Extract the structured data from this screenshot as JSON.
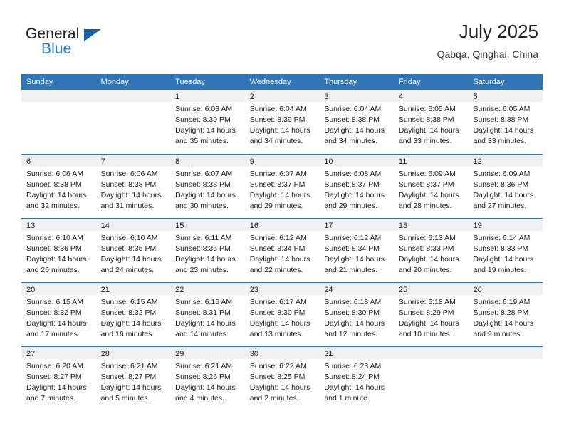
{
  "brand": {
    "name_part1": "General",
    "name_part2": "Blue",
    "triangle_icon": "triangle-icon",
    "accent_color": "#2b7cc4",
    "triangle_color": "#1360a8"
  },
  "header": {
    "title": "July 2025",
    "subtitle": "Qabqa, Qinghai, China"
  },
  "calendar": {
    "header_bg": "#3075b5",
    "day_band_bg": "#f0f0f0",
    "weekdays": [
      "Sunday",
      "Monday",
      "Tuesday",
      "Wednesday",
      "Thursday",
      "Friday",
      "Saturday"
    ],
    "weeks": [
      [
        {
          "day": "",
          "empty": true,
          "sunrise": "",
          "sunset": "",
          "daylight_1": "",
          "daylight_2": ""
        },
        {
          "day": "",
          "empty": true,
          "sunrise": "",
          "sunset": "",
          "daylight_1": "",
          "daylight_2": ""
        },
        {
          "day": "1",
          "sunrise": "Sunrise: 6:03 AM",
          "sunset": "Sunset: 8:39 PM",
          "daylight_1": "Daylight: 14 hours",
          "daylight_2": "and 35 minutes."
        },
        {
          "day": "2",
          "sunrise": "Sunrise: 6:04 AM",
          "sunset": "Sunset: 8:39 PM",
          "daylight_1": "Daylight: 14 hours",
          "daylight_2": "and 34 minutes."
        },
        {
          "day": "3",
          "sunrise": "Sunrise: 6:04 AM",
          "sunset": "Sunset: 8:38 PM",
          "daylight_1": "Daylight: 14 hours",
          "daylight_2": "and 34 minutes."
        },
        {
          "day": "4",
          "sunrise": "Sunrise: 6:05 AM",
          "sunset": "Sunset: 8:38 PM",
          "daylight_1": "Daylight: 14 hours",
          "daylight_2": "and 33 minutes."
        },
        {
          "day": "5",
          "sunrise": "Sunrise: 6:05 AM",
          "sunset": "Sunset: 8:38 PM",
          "daylight_1": "Daylight: 14 hours",
          "daylight_2": "and 33 minutes."
        }
      ],
      [
        {
          "day": "6",
          "sunrise": "Sunrise: 6:06 AM",
          "sunset": "Sunset: 8:38 PM",
          "daylight_1": "Daylight: 14 hours",
          "daylight_2": "and 32 minutes."
        },
        {
          "day": "7",
          "sunrise": "Sunrise: 6:06 AM",
          "sunset": "Sunset: 8:38 PM",
          "daylight_1": "Daylight: 14 hours",
          "daylight_2": "and 31 minutes."
        },
        {
          "day": "8",
          "sunrise": "Sunrise: 6:07 AM",
          "sunset": "Sunset: 8:38 PM",
          "daylight_1": "Daylight: 14 hours",
          "daylight_2": "and 30 minutes."
        },
        {
          "day": "9",
          "sunrise": "Sunrise: 6:07 AM",
          "sunset": "Sunset: 8:37 PM",
          "daylight_1": "Daylight: 14 hours",
          "daylight_2": "and 29 minutes."
        },
        {
          "day": "10",
          "sunrise": "Sunrise: 6:08 AM",
          "sunset": "Sunset: 8:37 PM",
          "daylight_1": "Daylight: 14 hours",
          "daylight_2": "and 29 minutes."
        },
        {
          "day": "11",
          "sunrise": "Sunrise: 6:09 AM",
          "sunset": "Sunset: 8:37 PM",
          "daylight_1": "Daylight: 14 hours",
          "daylight_2": "and 28 minutes."
        },
        {
          "day": "12",
          "sunrise": "Sunrise: 6:09 AM",
          "sunset": "Sunset: 8:36 PM",
          "daylight_1": "Daylight: 14 hours",
          "daylight_2": "and 27 minutes."
        }
      ],
      [
        {
          "day": "13",
          "sunrise": "Sunrise: 6:10 AM",
          "sunset": "Sunset: 8:36 PM",
          "daylight_1": "Daylight: 14 hours",
          "daylight_2": "and 26 minutes."
        },
        {
          "day": "14",
          "sunrise": "Sunrise: 6:10 AM",
          "sunset": "Sunset: 8:35 PM",
          "daylight_1": "Daylight: 14 hours",
          "daylight_2": "and 24 minutes."
        },
        {
          "day": "15",
          "sunrise": "Sunrise: 6:11 AM",
          "sunset": "Sunset: 8:35 PM",
          "daylight_1": "Daylight: 14 hours",
          "daylight_2": "and 23 minutes."
        },
        {
          "day": "16",
          "sunrise": "Sunrise: 6:12 AM",
          "sunset": "Sunset: 8:34 PM",
          "daylight_1": "Daylight: 14 hours",
          "daylight_2": "and 22 minutes."
        },
        {
          "day": "17",
          "sunrise": "Sunrise: 6:12 AM",
          "sunset": "Sunset: 8:34 PM",
          "daylight_1": "Daylight: 14 hours",
          "daylight_2": "and 21 minutes."
        },
        {
          "day": "18",
          "sunrise": "Sunrise: 6:13 AM",
          "sunset": "Sunset: 8:33 PM",
          "daylight_1": "Daylight: 14 hours",
          "daylight_2": "and 20 minutes."
        },
        {
          "day": "19",
          "sunrise": "Sunrise: 6:14 AM",
          "sunset": "Sunset: 8:33 PM",
          "daylight_1": "Daylight: 14 hours",
          "daylight_2": "and 19 minutes."
        }
      ],
      [
        {
          "day": "20",
          "sunrise": "Sunrise: 6:15 AM",
          "sunset": "Sunset: 8:32 PM",
          "daylight_1": "Daylight: 14 hours",
          "daylight_2": "and 17 minutes."
        },
        {
          "day": "21",
          "sunrise": "Sunrise: 6:15 AM",
          "sunset": "Sunset: 8:32 PM",
          "daylight_1": "Daylight: 14 hours",
          "daylight_2": "and 16 minutes."
        },
        {
          "day": "22",
          "sunrise": "Sunrise: 6:16 AM",
          "sunset": "Sunset: 8:31 PM",
          "daylight_1": "Daylight: 14 hours",
          "daylight_2": "and 14 minutes."
        },
        {
          "day": "23",
          "sunrise": "Sunrise: 6:17 AM",
          "sunset": "Sunset: 8:30 PM",
          "daylight_1": "Daylight: 14 hours",
          "daylight_2": "and 13 minutes."
        },
        {
          "day": "24",
          "sunrise": "Sunrise: 6:18 AM",
          "sunset": "Sunset: 8:30 PM",
          "daylight_1": "Daylight: 14 hours",
          "daylight_2": "and 12 minutes."
        },
        {
          "day": "25",
          "sunrise": "Sunrise: 6:18 AM",
          "sunset": "Sunset: 8:29 PM",
          "daylight_1": "Daylight: 14 hours",
          "daylight_2": "and 10 minutes."
        },
        {
          "day": "26",
          "sunrise": "Sunrise: 6:19 AM",
          "sunset": "Sunset: 8:28 PM",
          "daylight_1": "Daylight: 14 hours",
          "daylight_2": "and 9 minutes."
        }
      ],
      [
        {
          "day": "27",
          "sunrise": "Sunrise: 6:20 AM",
          "sunset": "Sunset: 8:27 PM",
          "daylight_1": "Daylight: 14 hours",
          "daylight_2": "and 7 minutes."
        },
        {
          "day": "28",
          "sunrise": "Sunrise: 6:21 AM",
          "sunset": "Sunset: 8:27 PM",
          "daylight_1": "Daylight: 14 hours",
          "daylight_2": "and 5 minutes."
        },
        {
          "day": "29",
          "sunrise": "Sunrise: 6:21 AM",
          "sunset": "Sunset: 8:26 PM",
          "daylight_1": "Daylight: 14 hours",
          "daylight_2": "and 4 minutes."
        },
        {
          "day": "30",
          "sunrise": "Sunrise: 6:22 AM",
          "sunset": "Sunset: 8:25 PM",
          "daylight_1": "Daylight: 14 hours",
          "daylight_2": "and 2 minutes."
        },
        {
          "day": "31",
          "sunrise": "Sunrise: 6:23 AM",
          "sunset": "Sunset: 8:24 PM",
          "daylight_1": "Daylight: 14 hours",
          "daylight_2": "and 1 minute."
        },
        {
          "day": "",
          "empty": true,
          "sunrise": "",
          "sunset": "",
          "daylight_1": "",
          "daylight_2": ""
        },
        {
          "day": "",
          "empty": true,
          "sunrise": "",
          "sunset": "",
          "daylight_1": "",
          "daylight_2": ""
        }
      ]
    ]
  }
}
